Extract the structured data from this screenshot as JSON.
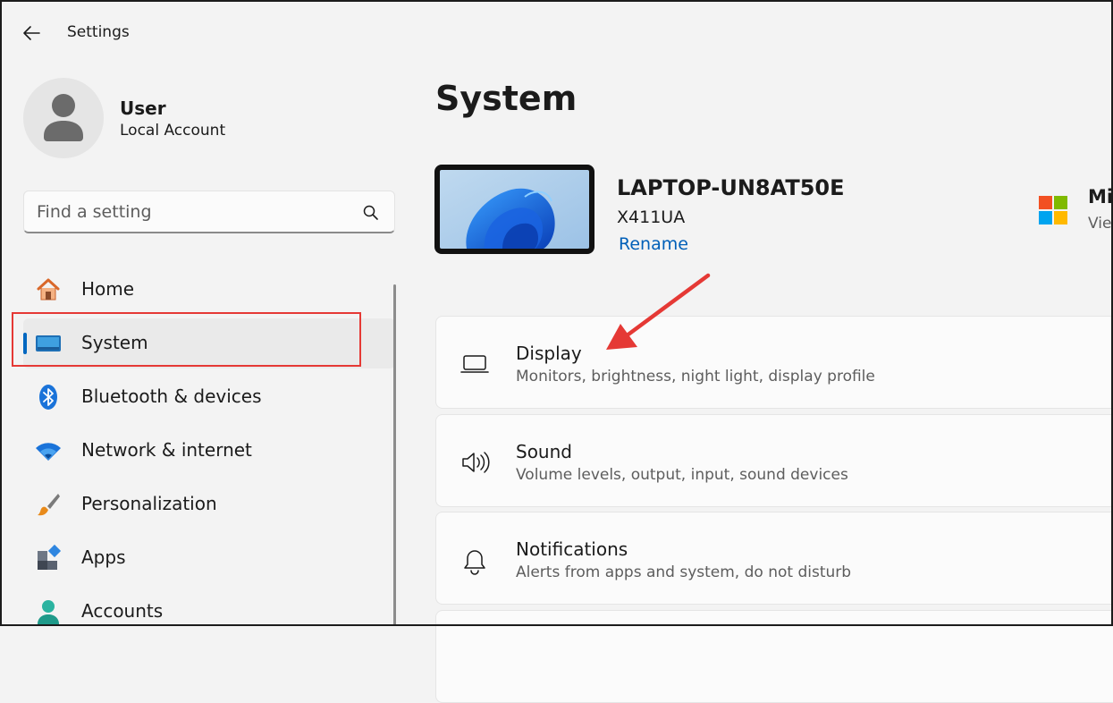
{
  "header": {
    "title": "Settings"
  },
  "user": {
    "name": "User",
    "account_type": "Local Account"
  },
  "search": {
    "placeholder": "Find a setting",
    "value": ""
  },
  "sidebar": {
    "items": [
      {
        "label": "Home",
        "icon": "home-icon",
        "active": false
      },
      {
        "label": "System",
        "icon": "monitor-icon",
        "active": true
      },
      {
        "label": "Bluetooth & devices",
        "icon": "bluetooth-icon",
        "active": false
      },
      {
        "label": "Network & internet",
        "icon": "wifi-icon",
        "active": false
      },
      {
        "label": "Personalization",
        "icon": "paintbrush-icon",
        "active": false
      },
      {
        "label": "Apps",
        "icon": "apps-icon",
        "active": false
      },
      {
        "label": "Accounts",
        "icon": "person-icon",
        "active": false
      }
    ]
  },
  "main": {
    "title": "System",
    "device": {
      "name": "LAPTOP-UN8AT50E",
      "model": "X411UA",
      "rename_label": "Rename"
    },
    "microsoft": {
      "title": "Mi",
      "subtitle": "Vie"
    },
    "cards": [
      {
        "title": "Display",
        "description": "Monitors, brightness, night light, display profile",
        "icon": "laptop-icon"
      },
      {
        "title": "Sound",
        "description": "Volume levels, output, input, sound devices",
        "icon": "speaker-icon"
      },
      {
        "title": "Notifications",
        "description": "Alerts from apps and system, do not disturb",
        "icon": "bell-icon"
      }
    ]
  },
  "colors": {
    "accent": "#0067c0",
    "link": "#005fb8",
    "annotation": "#e53935"
  }
}
